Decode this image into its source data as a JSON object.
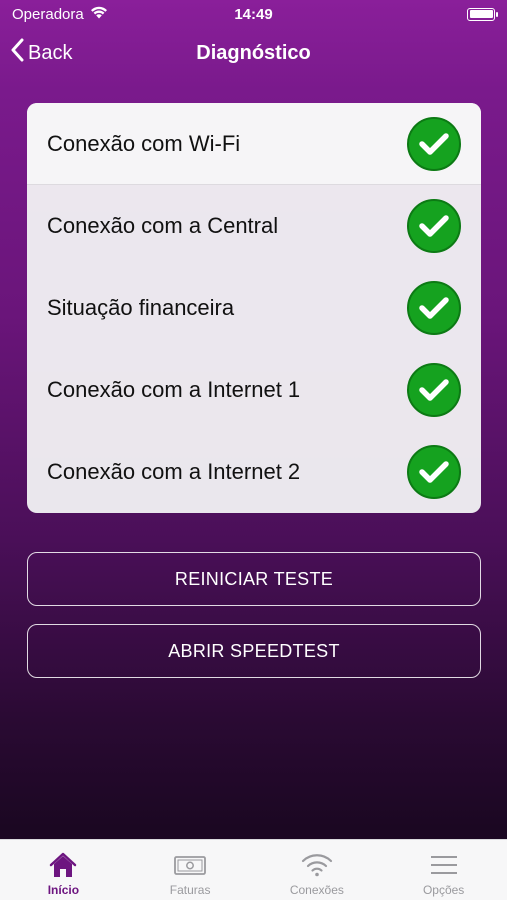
{
  "status_bar": {
    "carrier": "Operadora",
    "time": "14:49"
  },
  "nav": {
    "back_label": "Back",
    "title": "Diagnóstico"
  },
  "checks": [
    {
      "label": "Conexão com Wi-Fi",
      "status": "ok"
    },
    {
      "label": "Conexão com a Central",
      "status": "ok"
    },
    {
      "label": "Situação financeira",
      "status": "ok"
    },
    {
      "label": "Conexão com a Internet 1",
      "status": "ok"
    },
    {
      "label": "Conexão com a Internet 2",
      "status": "ok"
    }
  ],
  "actions": {
    "restart_label": "REINICIAR TESTE",
    "speedtest_label": "ABRIR SPEEDTEST"
  },
  "tabs": [
    {
      "label": "Início",
      "icon": "home-icon",
      "active": true
    },
    {
      "label": "Faturas",
      "icon": "bill-icon",
      "active": false
    },
    {
      "label": "Conexões",
      "icon": "wifi-icon",
      "active": false
    },
    {
      "label": "Opções",
      "icon": "menu-icon",
      "active": false
    }
  ],
  "colors": {
    "accent": "#6d1580",
    "success": "#15a21f",
    "inactive_tab": "#9a9a9e"
  }
}
